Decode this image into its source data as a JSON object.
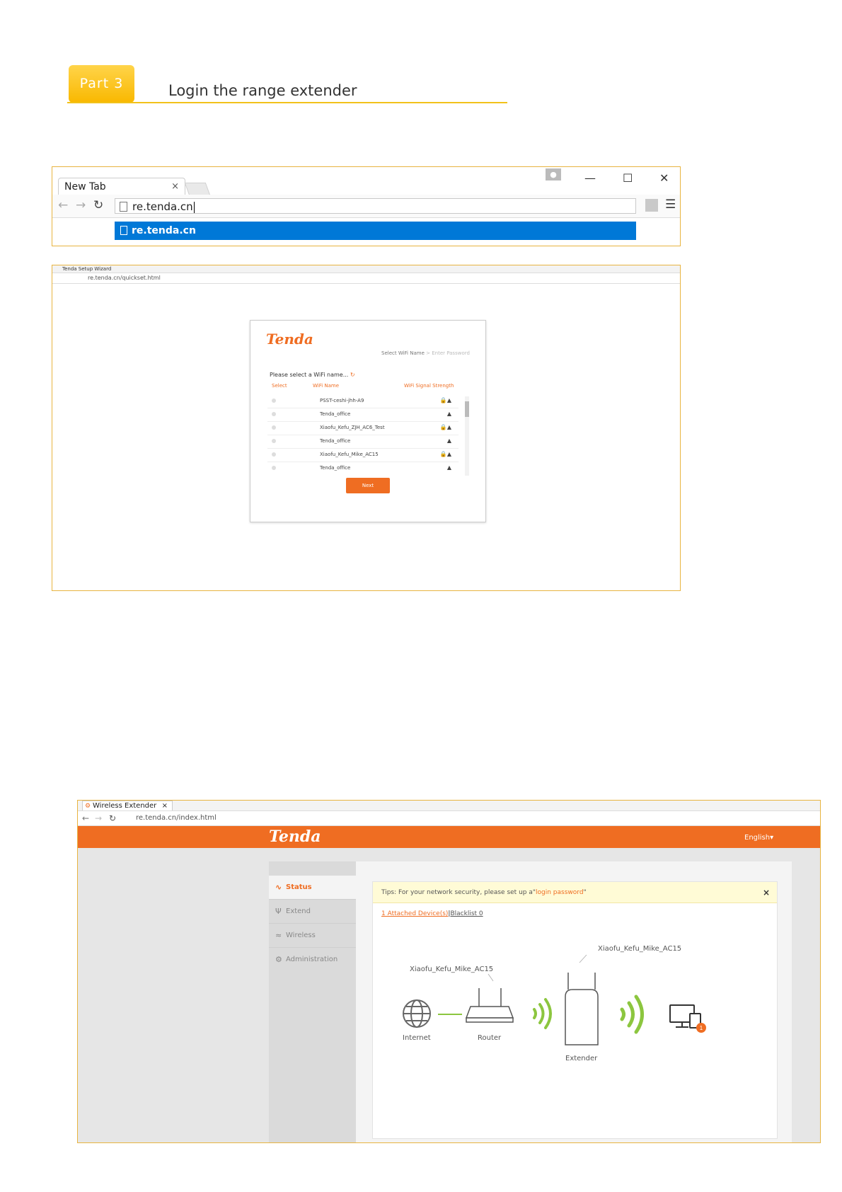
{
  "part": {
    "badge": "Part 3",
    "title": "Login the range extender"
  },
  "browser1": {
    "tab_title": "New Tab",
    "tab_close": "×",
    "window_minimize": "—",
    "window_maximize": "☐",
    "window_close": "✕",
    "address_value": "re.tenda.cn",
    "suggestion": "re.tenda.cn"
  },
  "wizard": {
    "tab_title": "Tenda Setup Wizard",
    "address": "re.tenda.cn/quickset.html",
    "logo": "Tenda",
    "steps": {
      "current": "Select WiFi Name",
      "separator": ">",
      "next": "Enter Password"
    },
    "prompt": "Please select a WiFi name...",
    "columns": {
      "select": "Select",
      "name": "WiFi Name",
      "strength": "WiFi Signal Strength"
    },
    "networks": [
      {
        "name": "PSST-ceshi-jhh-A9",
        "locked": true
      },
      {
        "name": "Tenda_office",
        "locked": false
      },
      {
        "name": "Xiaofu_Kefu_ZJH_AC6_Test",
        "locked": true
      },
      {
        "name": "Tenda_office",
        "locked": false
      },
      {
        "name": "Xiaofu_Kefu_Mike_AC15",
        "locked": true
      },
      {
        "name": "Tenda_office",
        "locked": false
      }
    ],
    "next_label": "Next"
  },
  "extender": {
    "tab_title": "Wireless Extender",
    "tab_close": "×",
    "address": "re.tenda.cn/index.html",
    "logo": "Tenda",
    "language": "English",
    "menu": [
      {
        "label": "Status",
        "icon": "pulse-icon",
        "active": true
      },
      {
        "label": "Extend",
        "icon": "antenna-icon",
        "active": false
      },
      {
        "label": "Wireless",
        "icon": "wifi-icon",
        "active": false
      },
      {
        "label": "Administration",
        "icon": "gear-icon",
        "active": false
      }
    ],
    "tip_prefix": "Tips: For your network security, please set up a\"",
    "tip_link": "login password",
    "tip_suffix": "\"",
    "tip_close": "×",
    "attached_link": "1 Attached Device(s)",
    "separator": "|",
    "blacklist_link": "Blacklist 0",
    "diagram": {
      "router_ssid": "Xiaofu_Kefu_Mike_AC15",
      "extender_ssid": "Xiaofu_Kefu_Mike_AC15",
      "internet_label": "Internet",
      "router_label": "Router",
      "extender_label": "Extender",
      "device_badge": "1"
    }
  },
  "colors": {
    "accent": "#ef6d22",
    "badge": "#f9b800",
    "selection": "#0078d7",
    "signal": "#8cc63f"
  }
}
